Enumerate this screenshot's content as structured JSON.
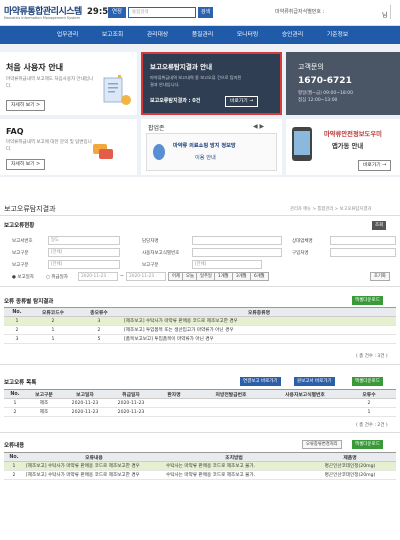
{
  "header": {
    "logo_title": "마약류통합관리시스템",
    "logo_sub": "Narcotics Information Management System",
    "timer": "29:52",
    "extend": "연장",
    "search_placeholder": "통합검색",
    "search_btn": "검색",
    "user_info": "마약류취급자식별번호 :",
    "user_name": "님"
  },
  "nav": [
    "업무관리",
    "보고조회",
    "관리대상",
    "품질관리",
    "모니터링",
    "승인관리",
    "기준정보"
  ],
  "card1": {
    "title": "처음 사용자 안내",
    "desc": "마약류취급내역 보고제도 처음사용자 안내입니다.",
    "btn": "자세히 보기 >"
  },
  "card2": {
    "title": "보고오류탐지결과 안내",
    "desc1": "마약류취급내역 보고내역 중 보고오류 건으로 탐지된",
    "desc2": "결과 안내입니다.",
    "result_label": "보고오류탐지결과 : 0건",
    "btn": "바로가기 →"
  },
  "card3": {
    "title": "고객문의",
    "phone": "1670-6721",
    "hours1": "평일(월~금) 09:00~18:00",
    "hours2": "점심 12:00~13:00"
  },
  "card4": {
    "title": "FAQ",
    "desc": "마약류취급내역 보고에 대한 문의 및 답변입니다.",
    "btn": "자세히 보기 >"
  },
  "card5": {
    "title": "팝업존",
    "line1": "마약류 의료쇼핑 방지 정보망",
    "line2": "이용 안내"
  },
  "card6": {
    "title1": "마약류안전정보도우미",
    "title2": "앱가동 안내",
    "btn": "바로가기 →"
  },
  "section": {
    "title": "보고오류탐지결과",
    "breadcrumb": "관리자 메뉴  >  통합관리  >  보고오류탐지결과"
  },
  "search": {
    "title": "보고오류현황",
    "lookup_btn": "조회",
    "reset_btn": "초기화",
    "label_doc_no": "보고서번호",
    "doc_no_val": "달도",
    "label_manager": "담당자명",
    "label_receiver": "상대업체명",
    "label_type": "보고구분",
    "type_val": "[전체]",
    "label_prod_no": "사용자보고식별번호",
    "label_buyer": "구입처명",
    "label_recv_type": "보고구분",
    "recv_val": "[전체]",
    "label_extra": "보고구분",
    "extra_val": "[전체]",
    "radio_a": "보고일자",
    "radio_b": "취급일자",
    "date_from": "2020-11-23",
    "date_tilde": "~",
    "date_to": "2020-11-23",
    "quick": [
      "어제",
      "오늘",
      "일주일",
      "1개월",
      "3개월",
      "6개월"
    ]
  },
  "t1": {
    "title": "오류 종류별 탐지결과",
    "excel": "엑셀다운로드",
    "cols": [
      "No.",
      "오류코드수",
      "총오류수",
      "오류종류명"
    ],
    "rows": [
      {
        "no": "1",
        "code": "2",
        "total": "3",
        "name": "[제조보고] 수탁사가 마약류 판매용 코드로 제조보고한 경우"
      },
      {
        "no": "2",
        "code": "1",
        "total": "2",
        "name": "[제조보고] 투입품목 또는 생산입고가 마약류가 아닌 경우"
      },
      {
        "no": "3",
        "code": "1",
        "total": "5",
        "name": "[품목보고보고] 투입품목이 마약류가 아닌 경우"
      }
    ],
    "count": "( 총 건수 :  3건 )"
  },
  "t2": {
    "title": "보고오류 목록",
    "btn1": "연결보고 바로가기",
    "btn2": "원보고서 바로가기",
    "excel": "엑셀다운로드",
    "cols": [
      "No.",
      "보고구분",
      "보고일자",
      "취급일자",
      "환자명",
      "처방전발급번호",
      "사용자보고식별번호",
      "오류수"
    ],
    "rows": [
      {
        "no": "1",
        "type": "제조",
        "rep": "2020-11-23",
        "han": "2020-11-23",
        "pat": "",
        "rx": "",
        "uid": "",
        "err": "2"
      },
      {
        "no": "2",
        "type": "제조",
        "rep": "2020-11-23",
        "han": "2020-11-23",
        "pat": "",
        "rx": "",
        "uid": "",
        "err": "1"
      }
    ],
    "count": "( 총 건수 :  2건 )"
  },
  "t3": {
    "title": "오류내용",
    "btn1": "오류종류변경처리",
    "excel": "엑셀다운로드",
    "cols": [
      "No.",
      "오류내용",
      "조치방법",
      "제품명"
    ],
    "rows": [
      {
        "no": "1",
        "err": "[제조보고] 수탁사가 마약류 판매용 코드로 제조보고한 경우",
        "fix": "수탁사는 마약류 판매용 코드로 제조보고 불가.",
        "prod": "명곤인산코데인정(20mg)"
      },
      {
        "no": "2",
        "err": "[제조보고] 수탁사가 마약류 판매용 코드로 제조보고한 경우",
        "fix": "수탁사는 마약류 판매용 코드로 제조보고 불가.",
        "prod": "명곤인산코데인정(20mg)"
      }
    ]
  }
}
